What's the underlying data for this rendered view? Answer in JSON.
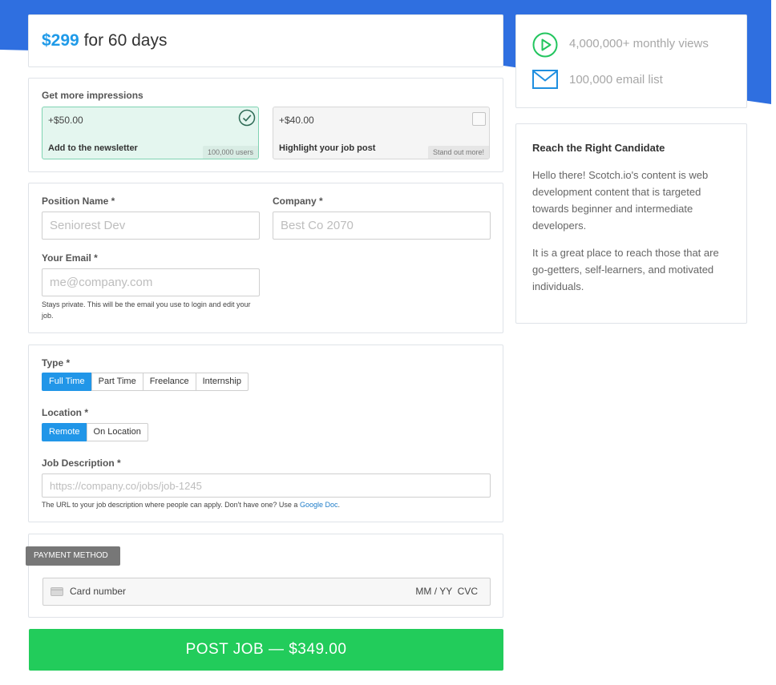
{
  "pricing": {
    "amount": "$299",
    "period": "for 60 days"
  },
  "impressions": {
    "label": "Get more impressions",
    "options": [
      {
        "price": "+$50.00",
        "title": "Add to the newsletter",
        "badge": "100,000 users",
        "selected": true
      },
      {
        "price": "+$40.00",
        "title": "Highlight your job post",
        "badge": "Stand out more!",
        "selected": false
      }
    ]
  },
  "form": {
    "position_label": "Position Name *",
    "position_placeholder": "Seniorest Dev",
    "company_label": "Company *",
    "company_placeholder": "Best Co 2070",
    "email_label": "Your Email *",
    "email_placeholder": "me@company.com",
    "email_help": "Stays private. This will be the email you use to login and edit your job."
  },
  "job": {
    "type_label": "Type *",
    "types": [
      "Full Time",
      "Part Time",
      "Freelance",
      "Internship"
    ],
    "location_label": "Location *",
    "locations": [
      "Remote",
      "On Location"
    ],
    "desc_label": "Job Description *",
    "desc_placeholder": "https://company.co/jobs/job-1245",
    "desc_help_text": "The URL to your job description where people can apply. Don't have one? Use a",
    "desc_help_link": "Google Doc",
    "desc_help_end": "."
  },
  "payment": {
    "tag": "PAYMENT METHOD",
    "card_placeholder": "Card number",
    "exp_cvc": "MM / YY  CVC"
  },
  "submit": {
    "label": "POST JOB — $349.00"
  },
  "stats": [
    {
      "icon": "play-circle-icon",
      "text": "4,000,000+ monthly views"
    },
    {
      "icon": "envelope-icon",
      "text": "100,000 email list"
    }
  ],
  "about": {
    "title": "Reach the Right Candidate",
    "p1": "Hello there! Scotch.io's content is web development content that is targeted towards beginner and intermediate developers.",
    "p2": "It is a great place to reach those that are go-getters, self-learners, and motivated individuals."
  },
  "colors": {
    "accent": "#2196e8",
    "green": "#22cc5b",
    "banner": "#2f6fe0"
  }
}
